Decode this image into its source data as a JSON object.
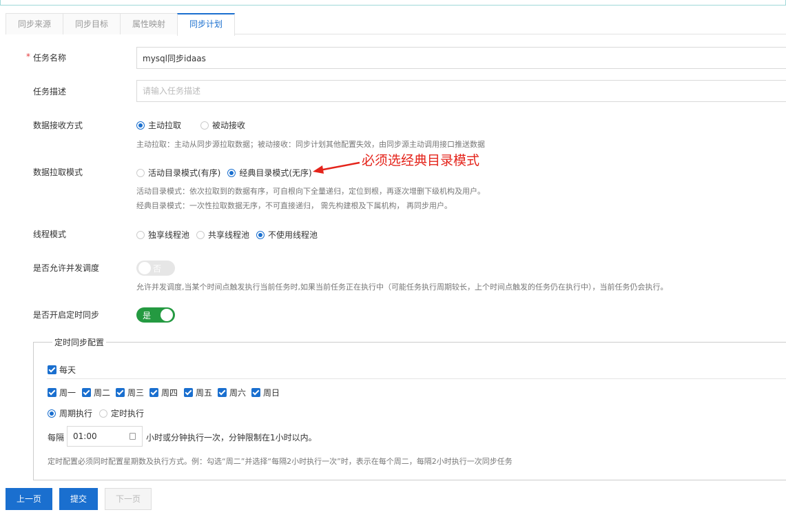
{
  "tabs": [
    "同步来源",
    "同步目标",
    "属性映射",
    "同步计划"
  ],
  "form": {
    "task_name": {
      "required_mark": "*",
      "label": "任务名称",
      "value": "mysql同步idaas"
    },
    "task_desc": {
      "label": "任务描述",
      "placeholder": "请输入任务描述"
    },
    "receive_mode": {
      "label": "数据接收方式",
      "options": [
        "主动拉取",
        "被动接收"
      ],
      "selected": "主动拉取",
      "hint": "主动拉取：主动从同步源拉取数据；被动接收：同步计划其他配置失效，由同步源主动调用接口推送数据"
    },
    "pull_mode": {
      "label": "数据拉取模式",
      "options": [
        "活动目录模式(有序)",
        "经典目录模式(无序)"
      ],
      "selected": "经典目录模式(无序)",
      "hint1": "活动目录模式：依次拉取到的数据有序，可自根向下全量递归，定位到根，再逐次增删下级机构及用户。",
      "hint2": "经典目录模式：一次性拉取数据无序，不可直接递归， 需先构建根及下属机构， 再同步用户。"
    },
    "annotation": "必须选经典目录模式",
    "thread_mode": {
      "label": "线程模式",
      "options": [
        "独享线程池",
        "共享线程池",
        "不使用线程池"
      ],
      "selected": "不使用线程池"
    },
    "concurrent": {
      "label": "是否允许并发调度",
      "state": "否",
      "hint": "允许并发调度,当某个时间点触发执行当前任务时,如果当前任务正在执行中（可能任务执行周期较长，上个时间点触发的任务仍在执行中），当前任务仍会执行。"
    },
    "scheduled": {
      "label": "是否开启定时同步",
      "state": "是"
    }
  },
  "schedule": {
    "legend": "定时同步配置",
    "every_day": "每天",
    "weekdays": [
      "周一",
      "周二",
      "周三",
      "周四",
      "周五",
      "周六",
      "周日"
    ],
    "exec_options": [
      "周期执行",
      "定时执行"
    ],
    "exec_selected": "周期执行",
    "interval_prefix": "每隔",
    "interval_value": "01:00",
    "interval_suffix": "小时或分钟执行一次，分钟限制在1小时以内。",
    "note": "定时配置必须同时配置星期数及执行方式。例：勾选“周二”并选择“每隔2小时执行一次”时，表示在每个周二，每隔2小时执行一次同步任务"
  },
  "buttons": {
    "prev": "上一页",
    "submit": "提交",
    "next": "下一页"
  },
  "colors": {
    "primary": "#1a6fcf",
    "switch_on": "#249a41",
    "annotation": "#e4231a"
  }
}
